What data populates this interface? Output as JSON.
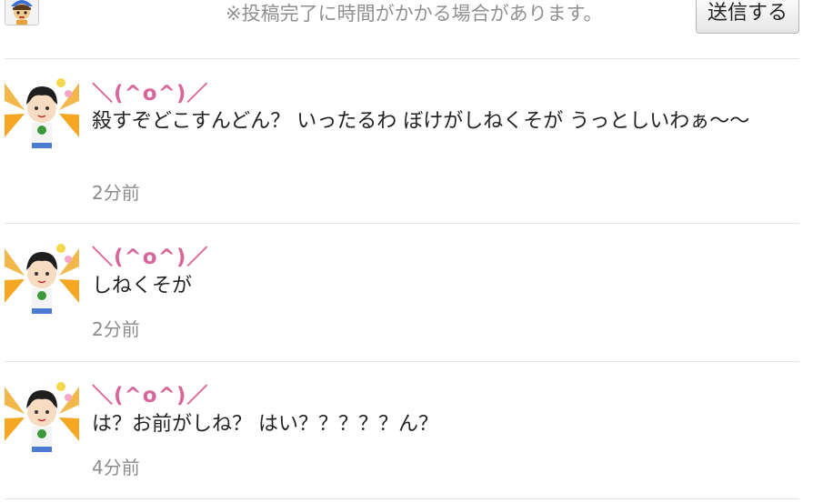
{
  "header": {
    "stamp_icon": "character-stamp-icon",
    "notice": "※投稿完了に時間がかかる場合があります。",
    "send_label": "送信する"
  },
  "posts": [
    {
      "username": "＼(^o^)／",
      "message": "殺すぞどこすんどん？ いったるわ ぼけがしねくそが うっとしいわぁ～～",
      "time": "2分前",
      "avatar_icon": "user-avatar-icon"
    },
    {
      "username": "＼(^o^)／",
      "message": "しねくそが",
      "time": "2分前",
      "avatar_icon": "user-avatar-icon"
    },
    {
      "username": "＼(^o^)／",
      "message": "は？お前がしね？ はい？？？？？ん？",
      "time": "4分前",
      "avatar_icon": "user-avatar-icon"
    }
  ],
  "colors": {
    "username": "#d9669a",
    "time": "#8c8c8c",
    "notice": "#909090",
    "divider": "#e4e4e4"
  }
}
